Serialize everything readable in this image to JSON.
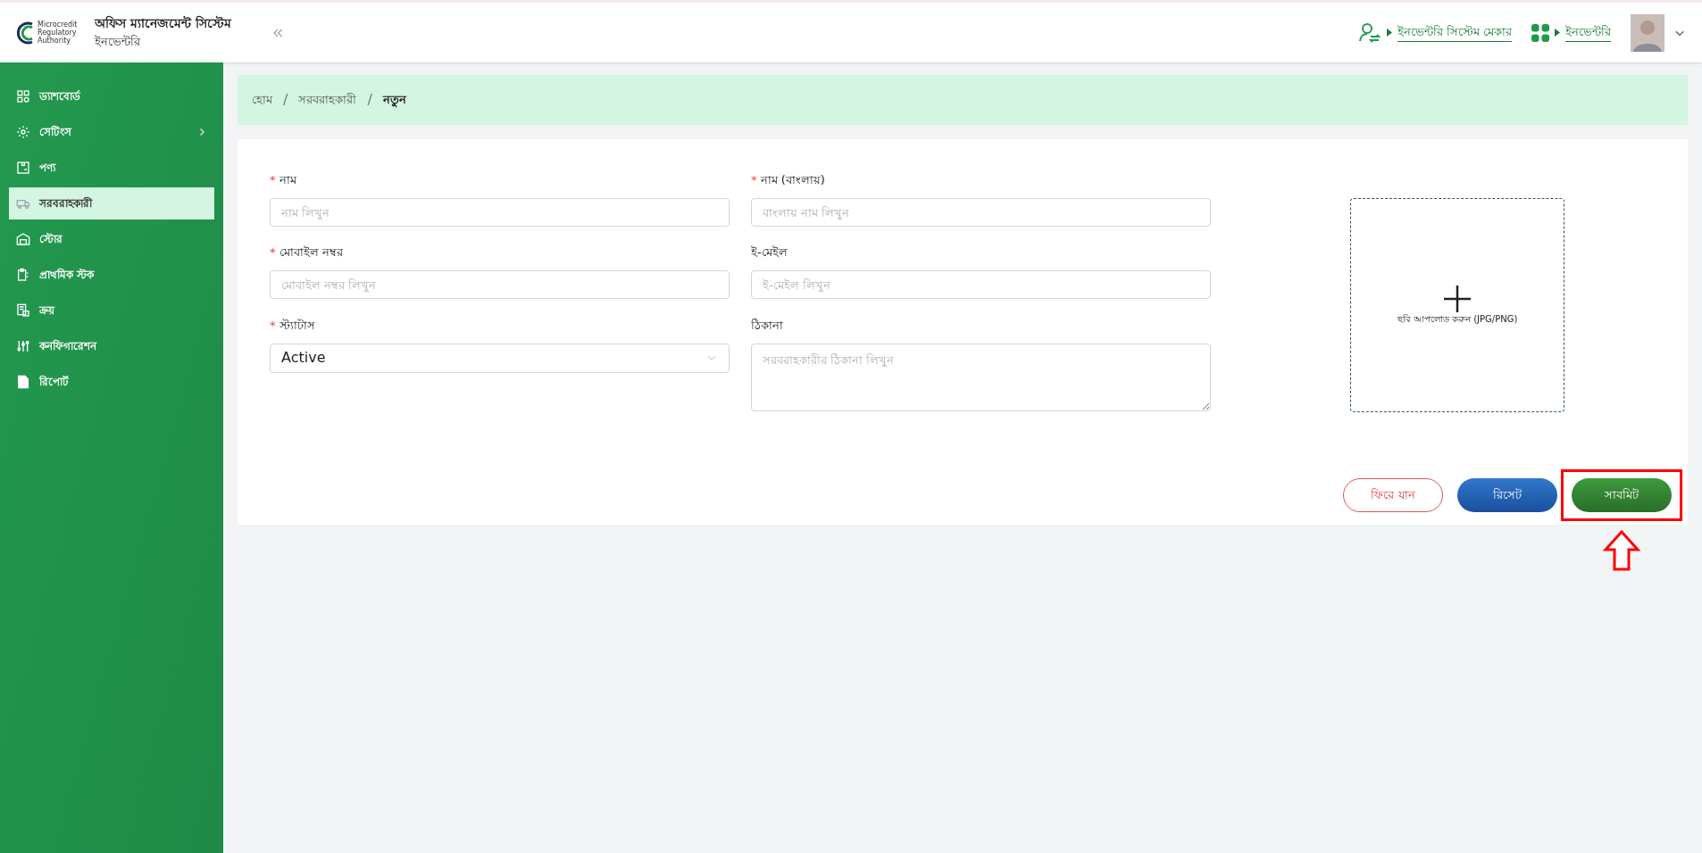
{
  "header": {
    "logo_text": [
      "Microcredit",
      "Regulatory",
      "Authority"
    ],
    "title": "অফিস ম্যানেজমেন্ট সিস্টেম",
    "subtitle": "ইনভেন্টরি",
    "links": [
      {
        "kind": "user-switch",
        "label": "ইনভেন্টরি সিস্টেম মেকার"
      },
      {
        "kind": "apps",
        "label": "ইনভেন্টরি"
      }
    ]
  },
  "sidebar": {
    "items": [
      {
        "label": "ড্যাশবোর্ড",
        "selected": false,
        "expandable": false
      },
      {
        "label": "সেটিংস",
        "selected": false,
        "expandable": true
      },
      {
        "label": "পণ্য",
        "selected": false,
        "expandable": false
      },
      {
        "label": "সরবরাহকারী",
        "selected": true,
        "expandable": false
      },
      {
        "label": "স্টোর",
        "selected": false,
        "expandable": false
      },
      {
        "label": "প্রাথমিক স্টক",
        "selected": false,
        "expandable": false
      },
      {
        "label": "ক্রয়",
        "selected": false,
        "expandable": false
      },
      {
        "label": "কনফিগারেশন",
        "selected": false,
        "expandable": false
      },
      {
        "label": "রিপোর্ট",
        "selected": false,
        "expandable": false
      }
    ]
  },
  "breadcrumb": [
    {
      "label": "হোম",
      "current": false
    },
    {
      "separator": "/",
      "label": "সরবরাহকারী",
      "current": false
    },
    {
      "separator": "/",
      "label": "নতুন",
      "current": true
    }
  ],
  "form": {
    "fields": [
      {
        "kind": "text",
        "required_mark": "*",
        "label": "নাম",
        "placeholder": "নাম লিখুন"
      },
      {
        "kind": "text",
        "required_mark": "*",
        "label": "নাম (বাংলায়)",
        "placeholder": "বাংলায় নাম লিখুন"
      },
      {
        "kind": "text",
        "required_mark": "*",
        "label": "মোবাইল নম্বর",
        "placeholder": "মোবাইল নম্বর লিখুন"
      },
      {
        "kind": "text",
        "label": "ই-মেইল",
        "placeholder": "ই-মেইল লিখুন"
      },
      {
        "kind": "select",
        "required_mark": "*",
        "label": "স্ট্যাটাস",
        "value": "Active"
      },
      {
        "kind": "textarea",
        "label": "ঠিকানা",
        "placeholder": "সরবরাহকারীর ঠিকানা লিখুন"
      }
    ],
    "upload": {
      "label": "ছবি আপলোড করুন (JPG/PNG)"
    },
    "buttons": [
      {
        "kind": "back",
        "label": "ফিরে যান",
        "highlighted": false
      },
      {
        "kind": "reset",
        "label": "রিসেট",
        "highlighted": false
      },
      {
        "kind": "submit",
        "label": "সাবমিট",
        "highlighted": true
      }
    ]
  }
}
